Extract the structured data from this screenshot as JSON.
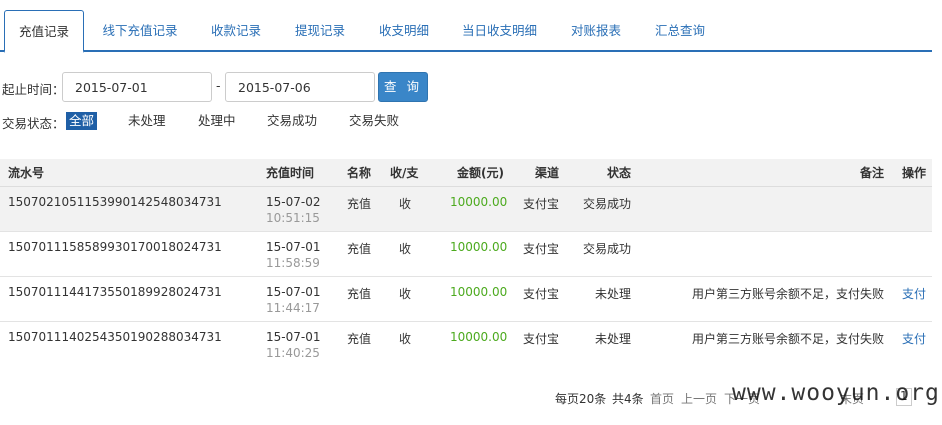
{
  "tabs": [
    {
      "label": "充值记录",
      "active": true
    },
    {
      "label": "线下充值记录"
    },
    {
      "label": "收款记录"
    },
    {
      "label": "提现记录"
    },
    {
      "label": "收支明细"
    },
    {
      "label": "当日收支明细"
    },
    {
      "label": "对账报表"
    },
    {
      "label": "汇总查询"
    }
  ],
  "filter": {
    "date_label": "起止时间：",
    "start_date": "2015-07-01",
    "separator": "-",
    "end_date": "2015-07-06",
    "query_button": "查 询"
  },
  "status_filter": {
    "label": "交易状态：",
    "options": [
      "全部",
      "未处理",
      "处理中",
      "交易成功",
      "交易失败"
    ],
    "selected": "全部"
  },
  "table": {
    "headers": [
      "流水号",
      "充值时间",
      "名称",
      "收/支",
      "金额(元)",
      "渠道",
      "状态",
      "备注",
      "操作"
    ],
    "rows": [
      {
        "serial": "150702105115399014254803473​1",
        "date": "15-07-02",
        "time": "10:51:15",
        "name": "充值",
        "direction": "收",
        "amount": "10000.00",
        "channel": "支付宝",
        "status": "交易成功",
        "remark": "",
        "action": ""
      },
      {
        "serial": "150701115858993017001802473​1",
        "date": "15-07-01",
        "time": "11:58:59",
        "name": "充值",
        "direction": "收",
        "amount": "10000.00",
        "channel": "支付宝",
        "status": "交易成功",
        "remark": "",
        "action": ""
      },
      {
        "serial": "150701114417355018992802473​1",
        "date": "15-07-01",
        "time": "11:44:17",
        "name": "充值",
        "direction": "收",
        "amount": "10000.00",
        "channel": "支付宝",
        "status": "未处理",
        "remark": "用户第三方账号余额不足，支付失败",
        "action": "支付"
      },
      {
        "serial": "150701114025435019028803473​1",
        "date": "15-07-01",
        "time": "11:40:25",
        "name": "充值",
        "direction": "收",
        "amount": "10000.00",
        "channel": "支付宝",
        "status": "未处理",
        "remark": "用户第三方账号余额不足，支付失败",
        "action": "支付"
      }
    ]
  },
  "pager": {
    "per_page": "每页20条",
    "total": "共4条",
    "first": "首页",
    "prev": "上一页",
    "next": "下一页",
    "last": "末页",
    "page": "1"
  },
  "watermark": "www.wooyun.org",
  "colors": {
    "accent": "#2a6fb6",
    "amount": "#4caa1e",
    "active_status": "#1f5fa6"
  }
}
